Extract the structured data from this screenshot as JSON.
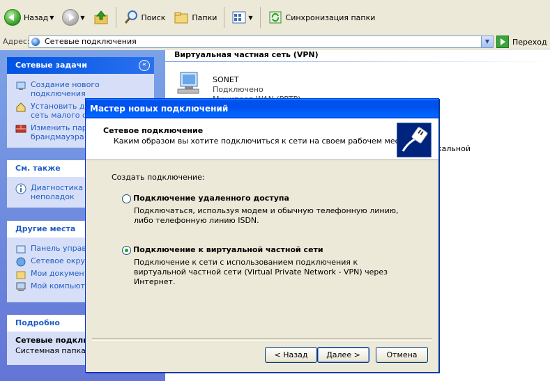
{
  "toolbar": {
    "back_label": "Назад",
    "search_label": "Поиск",
    "folders_label": "Папки",
    "sync_label": "Синхронизация папки"
  },
  "address": {
    "label": "Адрес:",
    "value": "Сетевые подключения",
    "go_label": "Переход"
  },
  "sidebar": {
    "network_tasks": {
      "title": "Сетевые задачи",
      "items": [
        {
          "label": "Создание нового подключения",
          "icon": "new-connection-icon"
        },
        {
          "label": "Установить домашнюю или сеть малого офиса",
          "icon": "home-network-icon"
        },
        {
          "label": "Изменить параметры брандмауэра Windows",
          "icon": "firewall-icon"
        }
      ]
    },
    "see_also": {
      "title": "См. также",
      "items": [
        {
          "label": "Диагностика сетевых неполадок",
          "icon": "info-icon"
        }
      ]
    },
    "other_places": {
      "title": "Другие места",
      "items": [
        {
          "label": "Панель управления",
          "icon": "control-panel-icon"
        },
        {
          "label": "Сетевое окружение",
          "icon": "network-places-icon"
        },
        {
          "label": "Мои документы",
          "icon": "documents-icon"
        },
        {
          "label": "Мой компьютер",
          "icon": "computer-icon"
        }
      ]
    },
    "details": {
      "title": "Подробно",
      "name": "Сетевые подключения",
      "type": "Системная папка"
    }
  },
  "content": {
    "section_title": "Виртуальная частная сеть (VPN)",
    "connection": {
      "name": "SONET",
      "status": "Подключено",
      "type": "Минипорт WAN (PPTP)"
    },
    "peek_text": "кальной"
  },
  "dialog": {
    "title": "Мастер новых подключений",
    "header_title": "Сетевое подключение",
    "header_subtitle": "Каким образом вы хотите подключиться к сети на своем рабочем месте?",
    "create_label": "Создать подключение:",
    "options": [
      {
        "label": "Подключение удаленного доступа",
        "description": "Подключаться, используя модем и обычную телефонную линию, либо телефонную линию ISDN.",
        "selected": false
      },
      {
        "label": "Подключение к виртуальной частной сети",
        "description": "Подключение к сети с использованием подключения к виртуальной частной сети (Virtual Private Network - VPN) через Интернет.",
        "selected": true
      }
    ],
    "buttons": {
      "back": "< Назад",
      "next": "Далее >",
      "cancel": "Отмена"
    }
  },
  "colors": {
    "title_bar": "#0054e3",
    "link": "#215dc6",
    "dialog_bg": "#ece9d8",
    "sidebar_bg": "#6375d6"
  }
}
